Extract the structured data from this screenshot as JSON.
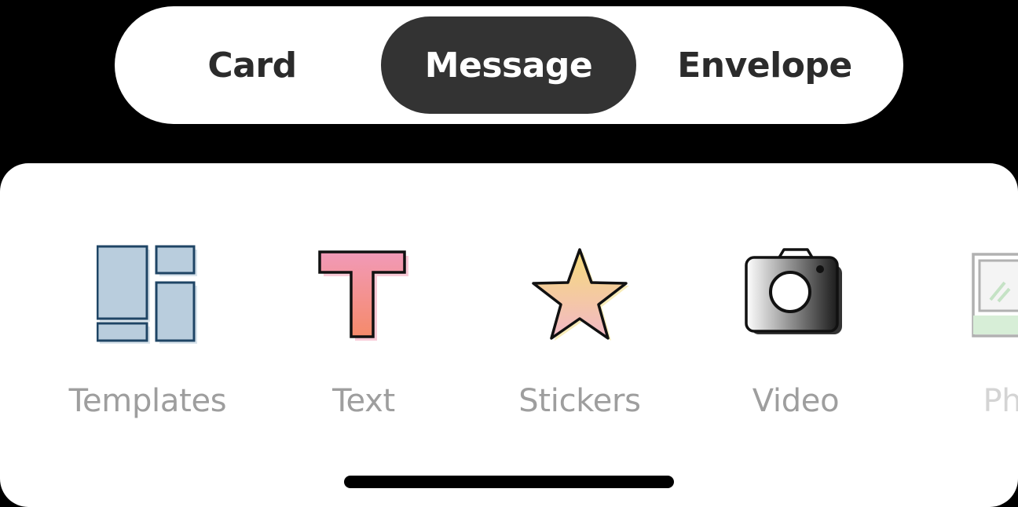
{
  "tabs": {
    "card": "Card",
    "message": "Message",
    "envelope": "Envelope",
    "selected": "Message"
  },
  "tools": {
    "templates": {
      "label": "Templates",
      "icon": "templates-icon"
    },
    "text": {
      "label": "Text",
      "icon": "text-icon"
    },
    "stickers": {
      "label": "Stickers",
      "icon": "star-icon"
    },
    "video": {
      "label": "Video",
      "icon": "camera-icon"
    },
    "photo": {
      "label": "Pho",
      "icon": "photo-icon"
    }
  },
  "colors": {
    "selected_tab_bg": "#333333",
    "tool_label": "#9e9e9e",
    "templates_fill": "#b9cddd",
    "templates_stroke": "#1f4565"
  }
}
